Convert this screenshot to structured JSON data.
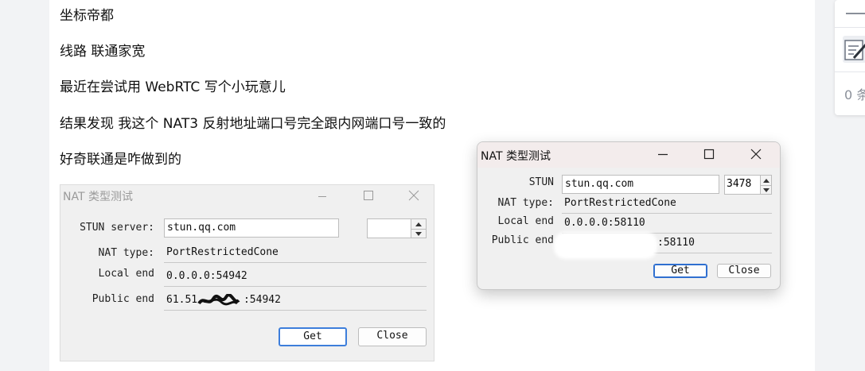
{
  "post": {
    "lines": [
      "坐标帝都",
      "线路 联通家宽",
      "最近在尝试用 WebRTC 写个小玩意儿",
      "结果发现 我这个 NAT3 反射地址端口号完全跟内网端口号一致的",
      "好奇联通是咋做到的"
    ]
  },
  "sidebar": {
    "count_text": "0 条",
    "icons": [
      "minus-icon",
      "edit-note-icon"
    ]
  },
  "screenshot_dialog": {
    "title": "NAT 类型测试",
    "stun_label": "STUN server:",
    "stun_value": "stun.qq.com",
    "port_value": "",
    "nat_type_label": "NAT type:",
    "nat_type_value": "PortRestrictedCone",
    "local_end_label": "Local end",
    "local_end_value": "0.0.0.0:54942",
    "public_end_label": "Public end",
    "public_end_prefix": "61.51.",
    "public_end_suffix": ":54942",
    "get_label": "Get",
    "close_label": "Close"
  },
  "app_dialog": {
    "title": "NAT 类型测试",
    "stun_label": "STUN",
    "stun_value": "stun.qq.com",
    "port_value": "3478",
    "nat_type_label": "NAT type:",
    "nat_type_value": "PortRestrictedCone",
    "local_end_label": "Local end",
    "local_end_value": "0.0.0.0:58110",
    "public_end_label": "Public end",
    "public_end_suffix": ":58110",
    "get_label": "Get",
    "close_label": "Close"
  },
  "colors": {
    "accent": "#2f6fd0",
    "dialog_bg": "#f0f0f0",
    "titlebar_bg": "#f3ecec"
  }
}
